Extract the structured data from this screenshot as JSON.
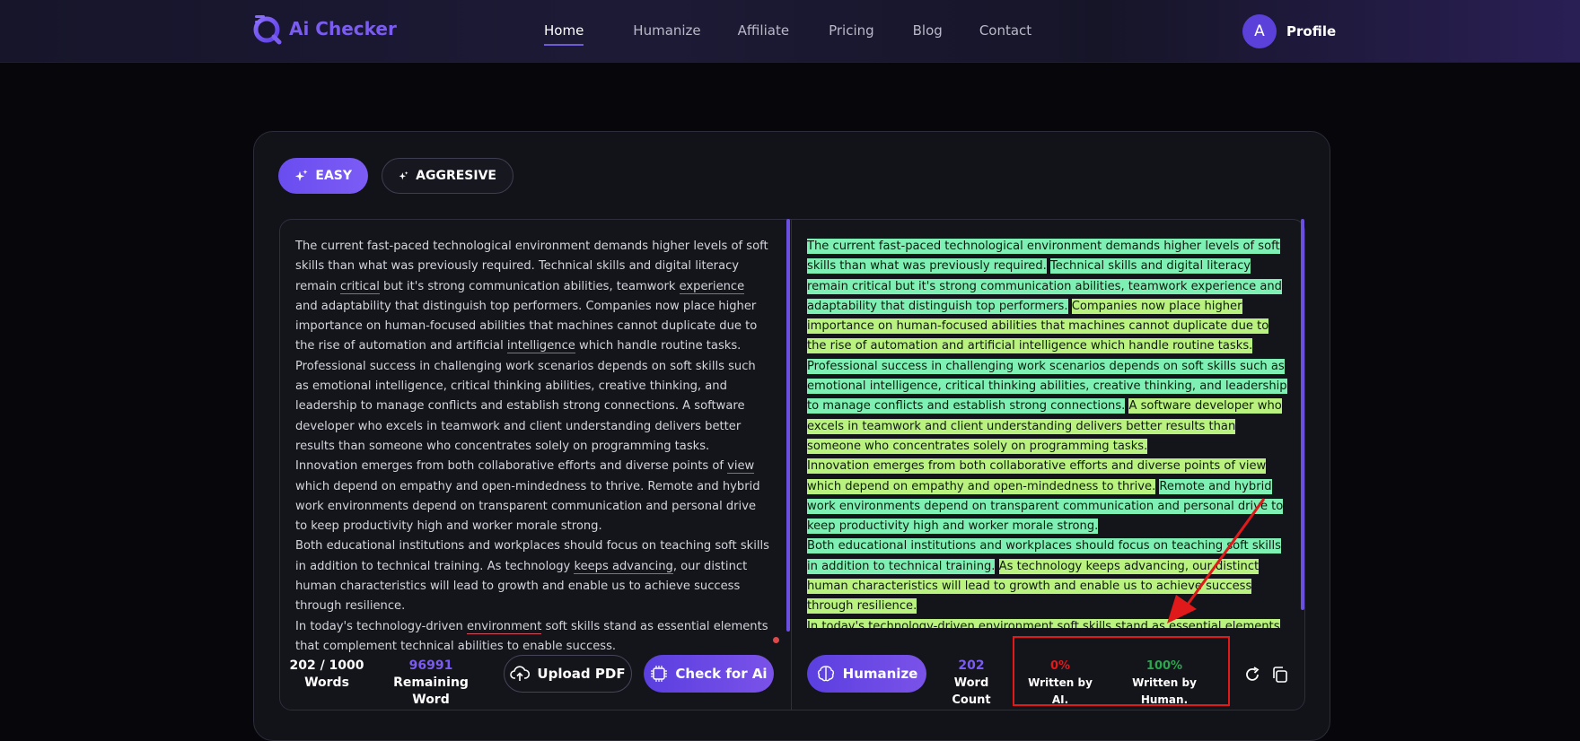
{
  "brand": {
    "name": "Ai Checker",
    "accent": "#7b5cf0"
  },
  "nav": {
    "items": [
      {
        "label": "Home",
        "active": true
      },
      {
        "label": "Humanize",
        "active": false
      },
      {
        "label": "Affiliate",
        "active": false
      },
      {
        "label": "Pricing",
        "active": false
      },
      {
        "label": "Blog",
        "active": false
      },
      {
        "label": "Contact",
        "active": false
      }
    ],
    "avatar_letter": "A",
    "profile_label": "Profile"
  },
  "modes": {
    "easy": "EASY",
    "aggressive": "AGGRESIVE",
    "selected": "EASY"
  },
  "input": {
    "paragraphs": [
      [
        {
          "t": "The current fast-paced technological environment demands higher levels of soft skills than what was previously required. Technical skills and digital literacy remain "
        },
        {
          "t": "critical",
          "u": true
        },
        {
          "t": " but it's strong communication abilities, teamwork "
        },
        {
          "t": "experience",
          "u": true
        },
        {
          "t": " and adaptability that distinguish top performers. Companies now place higher importance on human-focused abilities that machines cannot duplicate due to the rise of automation and artificial "
        },
        {
          "t": "intelligence",
          "u": true
        },
        {
          "t": " which handle routine tasks."
        }
      ],
      [
        {
          "t": "Professional success in challenging work scenarios depends on soft skills such as emotional intelligence, critical thinking abilities, creative thinking, and leadership to manage conflicts and establish strong connections. A software developer who excels in teamwork and client understanding delivers better results than someone who concentrates solely on programming tasks."
        }
      ],
      [
        {
          "t": "Innovation emerges from both collaborative efforts and diverse points of "
        },
        {
          "t": "view",
          "u": true
        },
        {
          "t": " which depend on empathy and open-mindedness to thrive. Remote and hybrid work environments depend on transparent communication and personal drive to keep productivity high and worker morale strong."
        }
      ],
      [
        {
          "t": "Both educational institutions and workplaces should focus on teaching soft skills in addition to technical training. As technology "
        },
        {
          "t": "keeps advancing",
          "u": true
        },
        {
          "t": ", our distinct human characteristics will lead to growth and enable us to achieve success through resilience."
        }
      ],
      [
        {
          "t": "In today's technology-driven "
        },
        {
          "t": "environment",
          "u": true
        },
        {
          "t": " soft skills stand as essential elements that complement technical abilities to enable success."
        }
      ]
    ],
    "word_count": "202 / 1000",
    "word_count_label": "Words",
    "remaining": "96991",
    "remaining_label": "Remaining Word",
    "upload_label": "Upload PDF",
    "check_label": "Check for Ai"
  },
  "output": {
    "paragraphs": [
      [
        {
          "t": "The current fast-paced technological environment demands higher levels of soft skills than what was previously required.",
          "c": "g"
        },
        {
          "t": " "
        },
        {
          "t": "Technical skills and digital literacy remain critical but it's strong communication abilities, teamwork experience and adaptability that distinguish top performers.",
          "c": "g"
        },
        {
          "t": " "
        },
        {
          "t": "Companies now place higher importance on human-focused abilities that machines cannot duplicate due to the rise of automation and artificial intelligence which handle routine tasks.",
          "c": "y"
        }
      ],
      [
        {
          "t": "Professional success in challenging work scenarios depends on soft skills such as emotional intelligence, critical thinking abilities, creative thinking, and leadership to manage conflicts and establish strong connections.",
          "c": "g"
        },
        {
          "t": " "
        },
        {
          "t": "A software developer who excels in teamwork and client understanding delivers better results than someone who concentrates solely on programming tasks.",
          "c": "y"
        }
      ],
      [
        {
          "t": "Innovation emerges from both collaborative efforts and diverse points of view which depend on empathy and open-mindedness to thrive.",
          "c": "y"
        },
        {
          "t": " "
        },
        {
          "t": "Remote and hybrid work environments depend on transparent communication and personal drive to keep productivity high and worker morale strong.",
          "c": "g"
        }
      ],
      [
        {
          "t": "Both educational institutions and workplaces should focus on teaching soft skills in addition to technical training.",
          "c": "g"
        },
        {
          "t": " "
        },
        {
          "t": "As technology keeps advancing, our distinct human characteristics will lead to growth and enable us to achieve success through resilience.",
          "c": "y"
        }
      ],
      [
        {
          "t": "In today's technology-driven environment soft skills stand as essential elements that complement technical abilities to enable success.",
          "c": "y"
        }
      ]
    ],
    "humanize_label": "Humanize",
    "word_count": "202",
    "word_count_label": "Word Count",
    "ai_percent": "0%",
    "ai_label": "Written by AI.",
    "human_percent": "100%",
    "human_label": "Written by Human.",
    "colors": {
      "ai": "#e0191b",
      "human": "#2ca64e",
      "count": "#7b5cf0"
    }
  }
}
